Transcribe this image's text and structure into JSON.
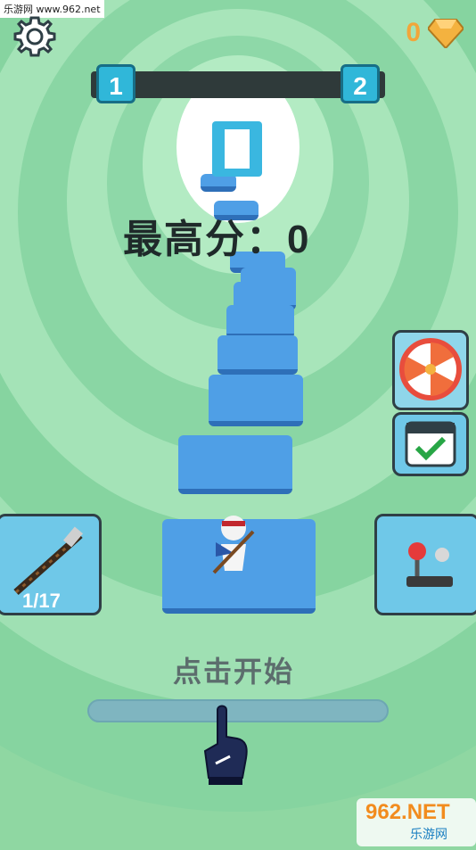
{
  "watermark": "乐游网 www.962.net",
  "gems": {
    "count": "0",
    "color": "#f4b23f"
  },
  "level_progress": {
    "current": "1",
    "next": "2"
  },
  "score": {
    "current": "0",
    "best_label": "最高分：0"
  },
  "buttons": {
    "sword": {
      "count": "1/17"
    },
    "wheel": {
      "icon": "prize-wheel-icon"
    },
    "calendar": {
      "icon": "calendar-check-icon"
    },
    "controller": {
      "icon": "joystick-icon"
    }
  },
  "start": {
    "label": "点击开始"
  },
  "logo": {
    "text": "962.NET",
    "sub": "乐游网"
  }
}
